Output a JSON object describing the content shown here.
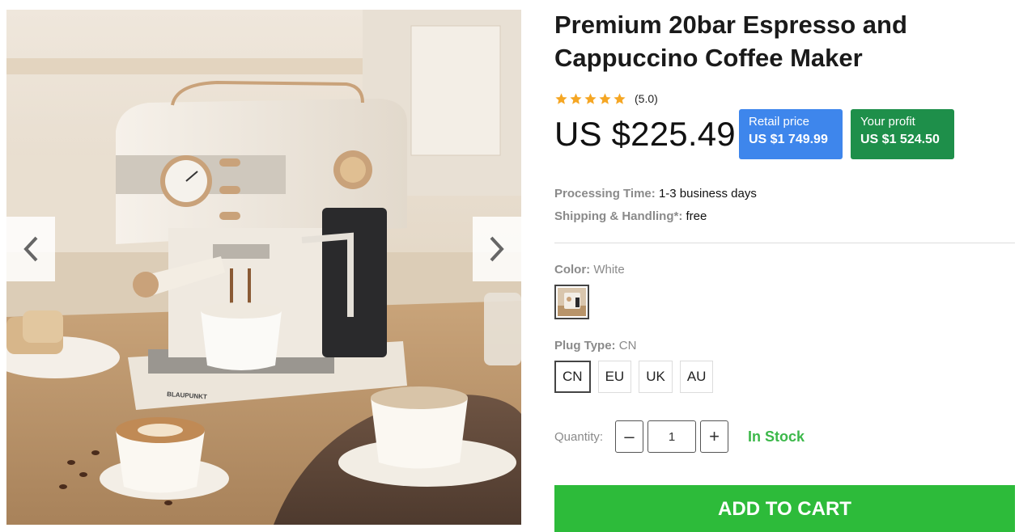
{
  "product": {
    "title": "Premium 20bar Espresso and Cappuccino Coffee Maker",
    "rating_text": "(5.0)",
    "rating_value": 5,
    "price": "US $225.49",
    "retail": {
      "label": "Retail price",
      "value": "US $1 749.99"
    },
    "profit": {
      "label": "Your profit",
      "value": "US $1 524.50"
    }
  },
  "shipping": {
    "processing_label": "Processing Time:",
    "processing_value": "1-3 business days",
    "handling_label": "Shipping & Handling*:",
    "handling_value": "free"
  },
  "options": {
    "color_label": "Color:",
    "color_value": "White",
    "plug_label": "Plug Type:",
    "plug_value": "CN",
    "plugs": [
      "CN",
      "EU",
      "UK",
      "AU"
    ]
  },
  "quantity": {
    "label": "Quantity:",
    "value": "1",
    "minus": "–",
    "plus": "+",
    "stock": "In Stock"
  },
  "cart": {
    "label": "ADD TO CART"
  },
  "icons": {
    "prev": "chevron-left-icon",
    "next": "chevron-right-icon",
    "star": "star-icon"
  },
  "colors": {
    "star": "#f5a623",
    "retail_bg": "#3e86ec",
    "profit_bg": "#1e8f4a",
    "stock": "#3cb84a",
    "cart_bg": "#2dbb3a"
  }
}
